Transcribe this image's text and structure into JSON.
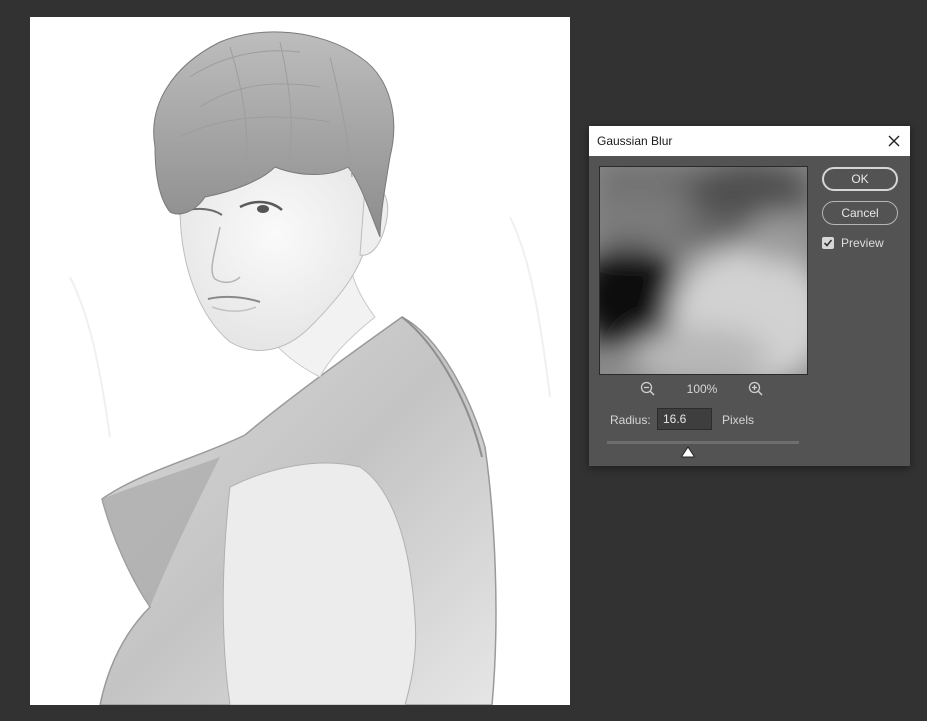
{
  "dialog": {
    "title": "Gaussian Blur",
    "ok_label": "OK",
    "cancel_label": "Cancel",
    "preview_label": "Preview",
    "preview_checked": true,
    "zoom": "100%",
    "radius_label": "Radius:",
    "radius_value": "16.6",
    "units": "Pixels",
    "radius_slider_fraction": 0.42
  },
  "icons": {
    "close": "close-icon",
    "zoom_out": "zoom-out-icon",
    "zoom_in": "zoom-in-icon",
    "check": "check-icon",
    "thumb": "slider-thumb-icon"
  },
  "colors": {
    "workspace": "#323232",
    "dialog_bg": "#535353",
    "title_bg": "#ffffff"
  }
}
